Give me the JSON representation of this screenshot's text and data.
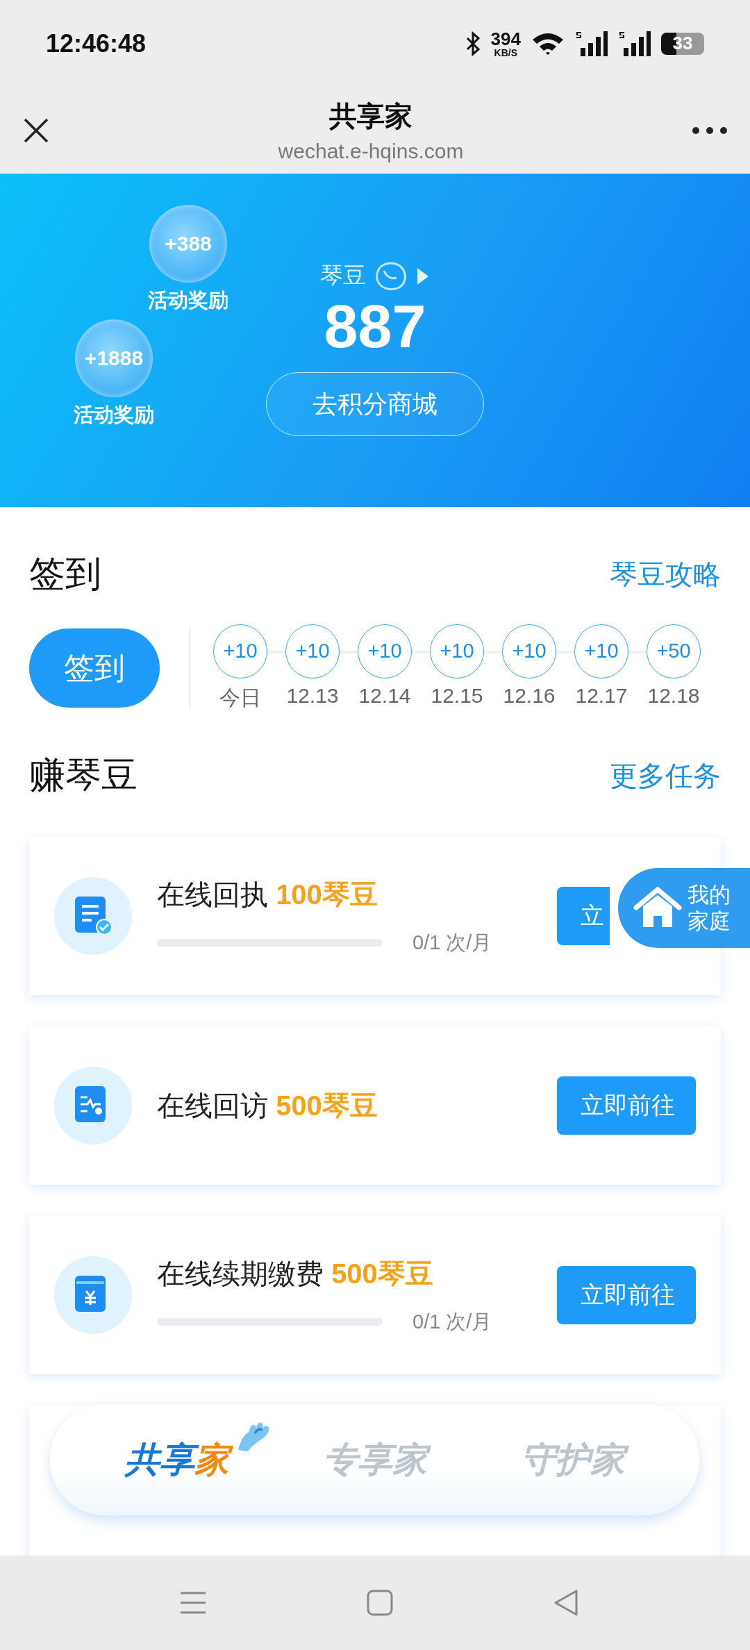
{
  "status_bar": {
    "time": "12:46:48",
    "speed": "394",
    "speed_unit": "KB/S",
    "battery": "33"
  },
  "nav": {
    "title": "共享家",
    "url": "wechat.e-hqins.com"
  },
  "banner": {
    "bubbles": [
      {
        "value": "+388",
        "label": "活动奖励"
      },
      {
        "value": "+1888",
        "label": "活动奖励"
      }
    ],
    "points_label": "琴豆",
    "points": "887",
    "mall_button": "去积分商城"
  },
  "signin": {
    "title": "签到",
    "link": "琴豆攻略",
    "button": "签到",
    "days": [
      {
        "points": "+10",
        "date": "今日"
      },
      {
        "points": "+10",
        "date": "12.13"
      },
      {
        "points": "+10",
        "date": "12.14"
      },
      {
        "points": "+10",
        "date": "12.15"
      },
      {
        "points": "+10",
        "date": "12.16"
      },
      {
        "points": "+10",
        "date": "12.17"
      },
      {
        "points": "+50",
        "date": "12.18"
      }
    ]
  },
  "earn": {
    "title": "赚琴豆",
    "link": "更多任务",
    "tasks": [
      {
        "kind": "partial",
        "name": "在线回执",
        "reward": "100琴豆",
        "level": 0,
        "count": "0/1 次/月",
        "button": "立"
      },
      {
        "kind": "full",
        "name": "在线回访",
        "reward": "500琴豆",
        "button": "立即前往"
      },
      {
        "kind": "full",
        "name": "在线续期缴费",
        "reward": "500琴豆",
        "level": 0,
        "count": "0/1 次/月",
        "button": "立即前往"
      },
      {
        "kind": "hidden"
      }
    ]
  },
  "float_button": {
    "label": "我的家庭"
  },
  "tabs": [
    {
      "label": "共享家",
      "selected": true
    },
    {
      "label": "专享家",
      "selected": false
    },
    {
      "label": "守护家",
      "selected": false
    }
  ]
}
